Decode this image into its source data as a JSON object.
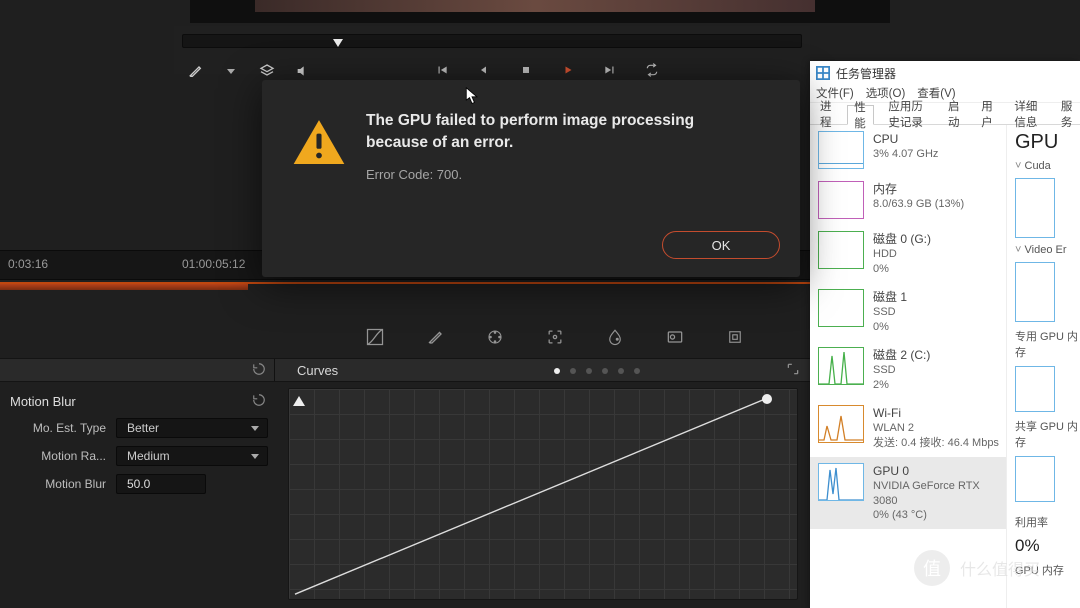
{
  "timeline": {
    "tc1": "0:03:16",
    "tc2": "01:00:05:12"
  },
  "modal": {
    "title_line1": "The GPU failed to perform image processing",
    "title_line2": "because of an error.",
    "code": "Error Code: 700.",
    "ok": "OK"
  },
  "curves": {
    "title": "Curves"
  },
  "motion": {
    "heading": "Motion Blur",
    "row1_label": "Mo. Est. Type",
    "row1_value": "Better",
    "row2_label": "Motion Ra...",
    "row2_value": "Medium",
    "row3_label": "Motion Blur",
    "row3_value": "50.0"
  },
  "tm": {
    "window_title": "任务管理器",
    "menu": {
      "file": "文件(F)",
      "options": "选项(O)",
      "view": "查看(V)"
    },
    "tabs": {
      "proc": "进程",
      "perf": "性能",
      "hist": "应用历史记录",
      "startup": "启动",
      "users": "用户",
      "details": "详细信息",
      "services": "服务"
    },
    "items": {
      "cpu": {
        "name": "CPU",
        "sub": "3%  4.07 GHz"
      },
      "mem": {
        "name": "内存",
        "sub": "8.0/63.9 GB (13%)"
      },
      "disk0": {
        "name": "磁盘 0 (G:)",
        "sub1": "HDD",
        "sub2": "0%"
      },
      "disk1": {
        "name": "磁盘 1",
        "sub1": "SSD",
        "sub2": "0%"
      },
      "disk2": {
        "name": "磁盘 2 (C:)",
        "sub1": "SSD",
        "sub2": "2%"
      },
      "wifi": {
        "name": "Wi-Fi",
        "sub1": "WLAN 2",
        "sub2": "发送: 0.4 接收: 46.4 Mbps"
      },
      "gpu": {
        "name": "GPU 0",
        "sub1": "NVIDIA GeForce RTX 3080",
        "sub2": "0%  (43 °C)"
      }
    },
    "right": {
      "title": "GPU",
      "cuda": "Cuda",
      "video": "Video Er",
      "mem1": "专用 GPU 内存",
      "mem2": "共享 GPU 内存",
      "util_label": "利用率",
      "util_val": "0%",
      "gmem_label": "GPU 内存"
    }
  },
  "watermark": {
    "text": "什么值得买"
  }
}
